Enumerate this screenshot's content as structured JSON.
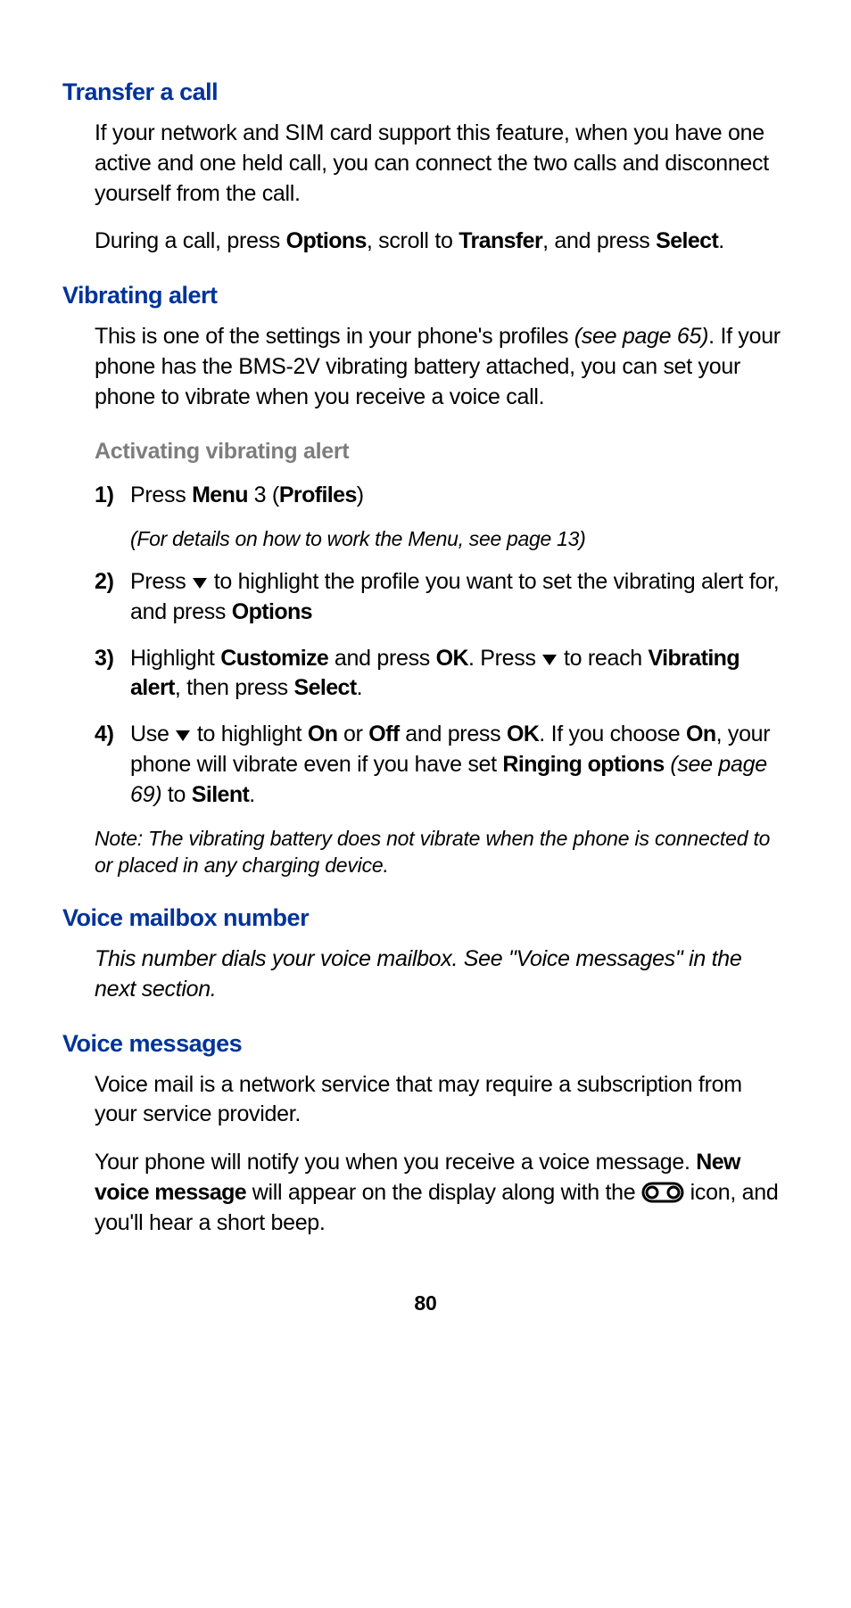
{
  "page_number": "80",
  "sections": {
    "transfer": {
      "heading": "Transfer a call",
      "p1": "If your network and SIM card support this feature, when you have one active and one held call, you can connect the two calls and disconnect yourself from the call.",
      "p2_a": "During a call, press ",
      "p2_b": "Options",
      "p2_c": ", scroll to ",
      "p2_d": "Transfer",
      "p2_e": ", and press ",
      "p2_f": "Select",
      "p2_g": "."
    },
    "vibrating": {
      "heading": "Vibrating alert",
      "p1_a": "This is one of the settings in your phone's profiles ",
      "p1_b": "(see page 65)",
      "p1_c": ". If your phone has the BMS-2V vibrating battery attached, you can set your phone to vibrate when you receive a voice call.",
      "subheading": "Activating vibrating alert",
      "step1_num": "1)",
      "step1_a": "Press ",
      "step1_b": "Menu",
      "step1_c": " 3 (",
      "step1_d": "Profiles",
      "step1_e": ")",
      "step1_note": "(For details on how to work the Menu, see page 13)",
      "step2_num": "2)",
      "step2_a": "Press ",
      "step2_b": " to highlight the profile you want to set the vibrating alert for, and press ",
      "step2_c": "Options",
      "step3_num": "3)",
      "step3_a": "Highlight ",
      "step3_b": "Customize",
      "step3_c": " and press ",
      "step3_d": "OK",
      "step3_e": ". Press ",
      "step3_f": " to reach ",
      "step3_g": "Vibrating alert",
      "step3_h": ", then press ",
      "step3_i": "Select",
      "step3_j": ".",
      "step4_num": "4)",
      "step4_a": "Use ",
      "step4_b": " to highlight ",
      "step4_c": "On",
      "step4_d": " or ",
      "step4_e": "Off",
      "step4_f": " and press ",
      "step4_g": "OK",
      "step4_h": ". If you choose ",
      "step4_i": "On",
      "step4_j": ", your phone will vibrate even if you have set ",
      "step4_k": "Ringing options",
      "step4_l": " (see page 69)",
      "step4_m": " to ",
      "step4_n": "Silent",
      "step4_o": ".",
      "note": "Note: The vibrating battery does not vibrate when the phone is connected to or placed in any charging device."
    },
    "mailbox": {
      "heading": "Voice mailbox number",
      "p1": "This number dials your voice mailbox. See \"Voice messages\" in the next section."
    },
    "voicemsg": {
      "heading": "Voice messages",
      "p1": "Voice mail is a network service that may require a subscription from your service provider.",
      "p2_a": "Your phone will notify you when you receive a voice message. ",
      "p2_b": "New voice message",
      "p2_c": " will appear on the display along with the ",
      "p2_d": " icon, and you'll hear a short beep."
    }
  }
}
